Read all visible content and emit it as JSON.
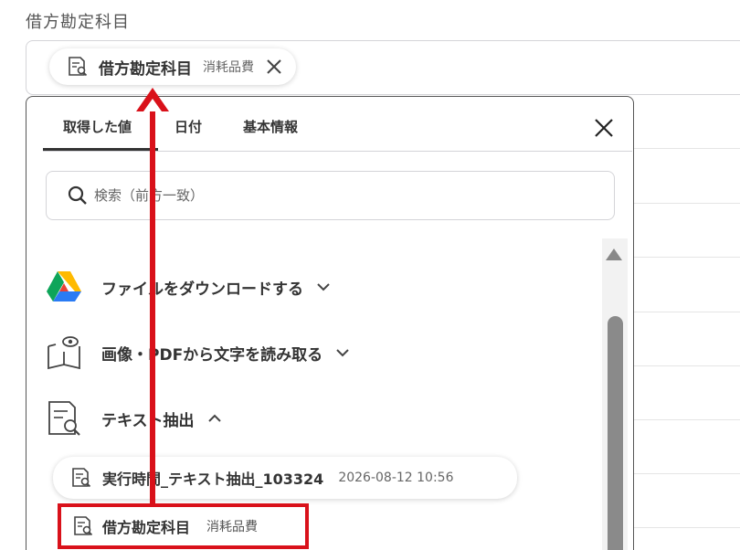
{
  "field": {
    "label": "借方勘定科目",
    "selected_chip": {
      "title": "借方勘定科目",
      "value": "消耗品費"
    }
  },
  "popup": {
    "tabs": [
      {
        "label": "取得した値",
        "active": true
      },
      {
        "label": "日付",
        "active": false
      },
      {
        "label": "基本情報",
        "active": false
      }
    ],
    "search": {
      "placeholder": "検索（前方一致）",
      "value": ""
    },
    "sections": [
      {
        "label": "ファイルをダウンロードする",
        "icon": "google-drive-icon",
        "expanded": false
      },
      {
        "label": "画像・PDFから文字を読み取る",
        "icon": "book-eye-icon",
        "expanded": false
      },
      {
        "label": "テキスト抽出",
        "icon": "document-search-icon",
        "expanded": true
      }
    ],
    "items": [
      {
        "title": "実行時間_テキスト抽出_103324",
        "value": "2026-08-12 10:56"
      },
      {
        "title": "借方勘定科目",
        "value": "消耗品費"
      }
    ]
  },
  "annotation": {
    "color": "#d9111a"
  }
}
